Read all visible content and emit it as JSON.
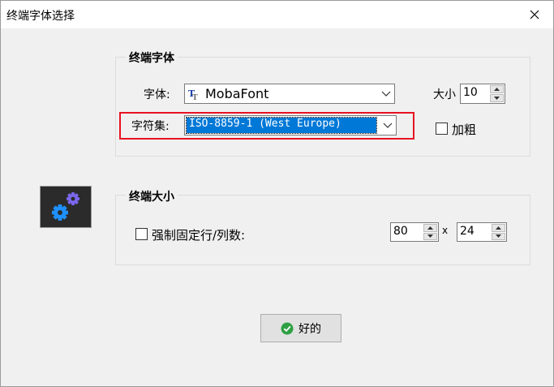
{
  "window": {
    "title": "终端字体选择"
  },
  "font_group": {
    "title": "终端字体",
    "font_label": "字体:",
    "font_value": "MobaFont",
    "size_label": "大小",
    "size_value": "10",
    "charset_label": "字符集:",
    "charset_value": "ISO-8859-1 (West Europe)",
    "bold_label": "加粗",
    "bold_checked": false
  },
  "size_group": {
    "title": "终端大小",
    "force_label": "强制固定行/列数:",
    "force_checked": false,
    "cols_value": "80",
    "separator": "x",
    "rows_value": "24"
  },
  "ok_button": {
    "label": "好的"
  },
  "colors": {
    "highlight_border": "#e81123",
    "selection_bg": "#0078d7",
    "ok_icon": "#2ea043",
    "gear_large": "#1e90ff",
    "gear_small": "#7b68ee"
  },
  "icons": {
    "close": "close-icon",
    "font": "truetype-font-icon",
    "settings": "gears-icon",
    "ok": "check-circle-icon"
  }
}
